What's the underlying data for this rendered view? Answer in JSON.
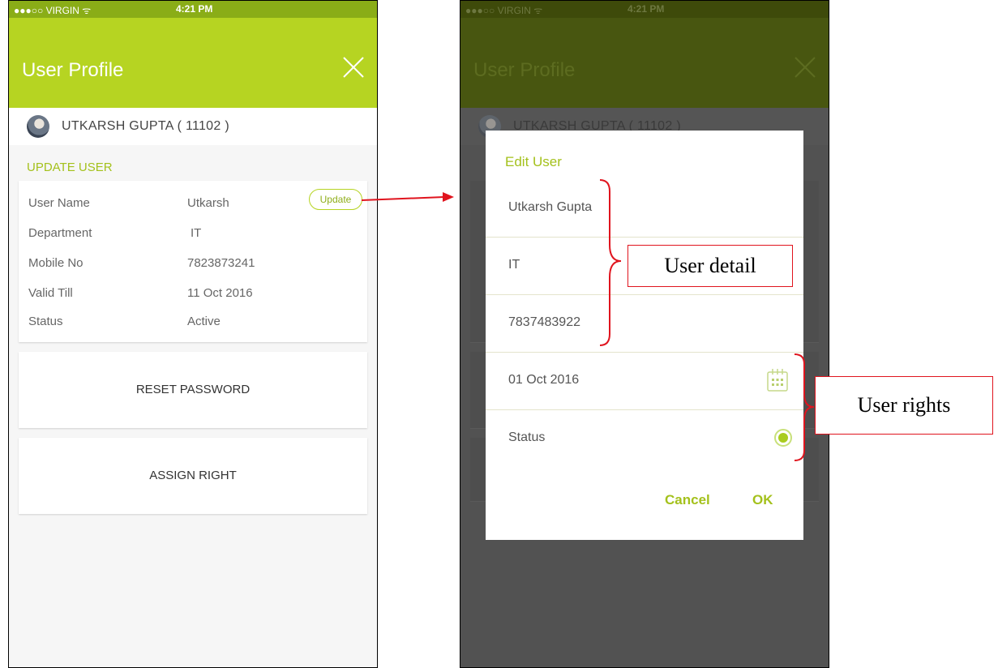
{
  "status_bar": {
    "carrier": "●●●○○ VIRGIN ᯤ",
    "time": "4:21 PM"
  },
  "header": {
    "title": "User Profile",
    "close_icon": "close-icon"
  },
  "user": {
    "display": "UTKARSH GUPTA ( 11102 )"
  },
  "profile": {
    "section_title": "UPDATE USER",
    "update_label": "Update",
    "rows": [
      {
        "label": "User Name",
        "value": "Utkarsh"
      },
      {
        "label": "Department",
        "value": "IT"
      },
      {
        "label": "Mobile No",
        "value": "7823873241"
      },
      {
        "label": "Valid Till",
        "value": "11 Oct 2016"
      },
      {
        "label": "Status",
        "value": "Active"
      }
    ],
    "reset_password": "RESET PASSWORD",
    "assign_right": "ASSIGN RIGHT"
  },
  "dialog": {
    "title": "Edit User",
    "name": "Utkarsh Gupta",
    "department": "IT",
    "mobile": "7837483922",
    "valid_till": "01 Oct 2016",
    "status_label": "Status",
    "status_selected": true,
    "cancel": "Cancel",
    "ok": "OK"
  },
  "annotations": {
    "user_detail": "User detail",
    "user_rights": "User rights"
  },
  "colors": {
    "accent": "#b6d422",
    "status_bar": "#8aad17",
    "arrow": "#e0141e"
  }
}
